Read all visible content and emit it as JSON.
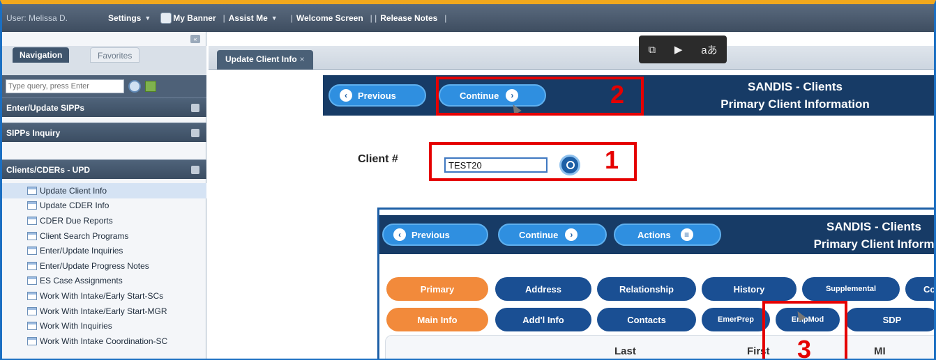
{
  "topbar": {
    "user": "User: Melissa D.",
    "settings": "Settings",
    "my_banner": "My Banner",
    "assist_me": "Assist Me",
    "welcome": "Welcome Screen",
    "release_notes": "Release Notes"
  },
  "float_tools": [
    "⧉",
    "▶",
    "aあ"
  ],
  "nav": {
    "tab_navigation": "Navigation",
    "tab_favorites": "Favorites",
    "search_placeholder": "Type query, press Enter",
    "sections": [
      "Enter/Update SIPPs",
      "SIPPs Inquiry",
      "Clients/CDERs - UPD"
    ],
    "items": [
      "Update Client Info",
      "Update CDER Info",
      "CDER Due Reports",
      "Client Search Programs",
      "Enter/Update Inquiries",
      "Enter/Update Progress Notes",
      "ES Case Assignments",
      "Work With Intake/Early Start-SCs",
      "Work With Intake/Early Start-MGR",
      "Work With Inquiries",
      "Work With Intake Coordination-SC"
    ]
  },
  "doc_tab": {
    "label": "Update Client Info",
    "close": "×"
  },
  "panel": {
    "previous": "Previous",
    "continue": "Continue",
    "title_line1": "SANDIS - Clients",
    "title_line2": "Primary Client Information",
    "client_label": "Client #",
    "client_value": "TEST20"
  },
  "inset": {
    "previous": "Previous",
    "continue": "Continue",
    "actions": "Actions",
    "title_line1": "SANDIS - Clients",
    "title_line2": "Primary Client Inform",
    "tabs_row1": [
      "Primary",
      "Address",
      "Relationship",
      "History",
      "Supplemental",
      "Co"
    ],
    "tabs_row2": [
      "Main Info",
      "Add'l Info",
      "Contacts",
      "EmerPrep",
      "EmpMod",
      "SDP"
    ],
    "grid_headers": [
      "Last",
      "First",
      "MI"
    ]
  },
  "callouts": [
    "1",
    "2",
    "3"
  ],
  "colors": {
    "accent_orange": "#f28a3b",
    "nav_blue": "#1a4f93",
    "callout_red": "#e50000"
  }
}
